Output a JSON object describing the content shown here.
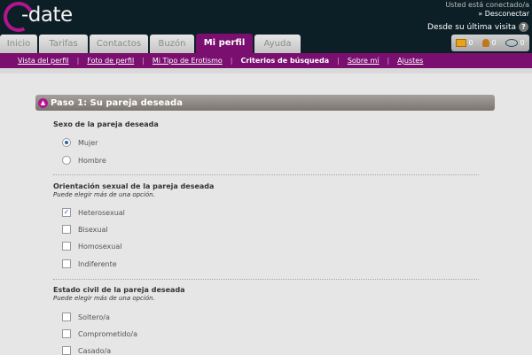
{
  "header": {
    "logo_text": "-date",
    "connected_text": "Usted está conectado/a",
    "disconnect": "» Desconectar",
    "last_visit": "Desde su última visita",
    "help_glyph": "?"
  },
  "tabs": [
    {
      "label": "Inicio",
      "active": false
    },
    {
      "label": "Tarifas",
      "active": false
    },
    {
      "label": "Contactos",
      "active": false
    },
    {
      "label": "Buzón",
      "active": false
    },
    {
      "label": "Mi perfil",
      "active": true
    },
    {
      "label": "Ayuda",
      "active": false
    }
  ],
  "counters": [
    {
      "icon": "envelope-icon",
      "value": "0"
    },
    {
      "icon": "person-icon",
      "value": "0"
    },
    {
      "icon": "eye-icon",
      "value": "0"
    }
  ],
  "subnav": [
    {
      "label": "Vista del perfil"
    },
    {
      "label": "Foto de perfil"
    },
    {
      "label": "Mi Tipo de Erotismo"
    },
    {
      "label": "Criterios de búsqueda",
      "current": true
    },
    {
      "label": "Sobre mí"
    },
    {
      "label": "Ajustes"
    }
  ],
  "section": {
    "title": "Paso 1: Su pareja deseada"
  },
  "groups": {
    "sex": {
      "title": "Sexo de la pareja deseada",
      "options": [
        {
          "label": "Mujer",
          "selected": true
        },
        {
          "label": "Hombre",
          "selected": false
        }
      ]
    },
    "orientation": {
      "title": "Orientación sexual de la pareja deseada",
      "hint": "Puede elegir más de una opción.",
      "options": [
        {
          "label": "Heterosexual",
          "checked": true
        },
        {
          "label": "Bisexual",
          "checked": false
        },
        {
          "label": "Homosexual",
          "checked": false
        },
        {
          "label": "Indiferente",
          "checked": false
        }
      ]
    },
    "civil": {
      "title": "Estado civil de la pareja deseada",
      "hint": "Puede elegir más de una opción.",
      "options": [
        {
          "label": "Soltero/a",
          "checked": false
        },
        {
          "label": "Comprometido/a",
          "checked": false
        },
        {
          "label": "Casado/a",
          "checked": false
        }
      ]
    }
  },
  "colors": {
    "brand": "#7a0f6f",
    "logo_accent": "#b5148f",
    "topbar": "#0d1f26"
  }
}
